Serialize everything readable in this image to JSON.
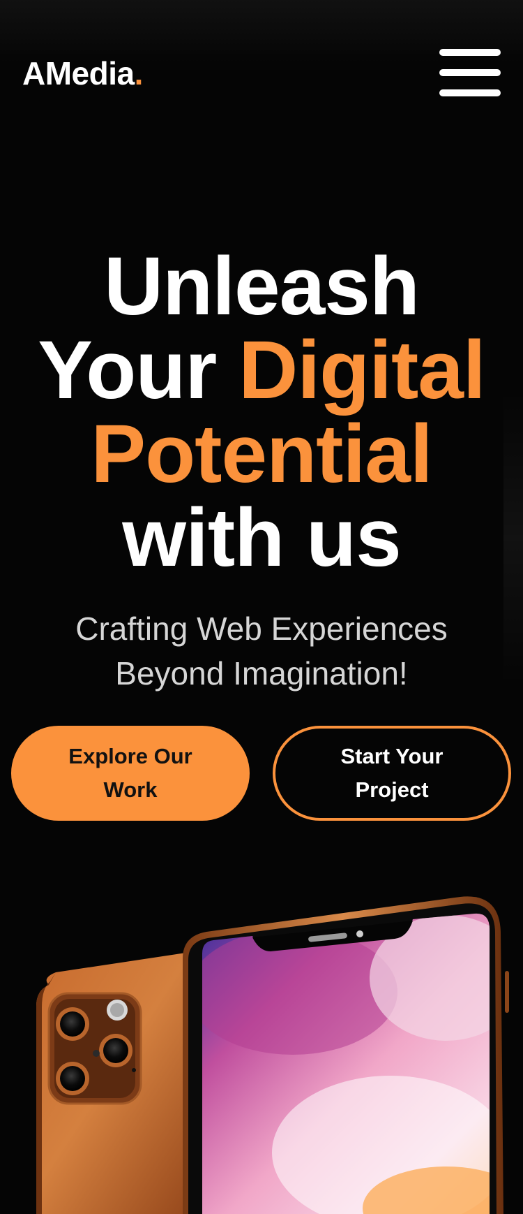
{
  "header": {
    "logo_text": "AMedia",
    "logo_dot": ".",
    "menu_icon": "hamburger-menu-icon"
  },
  "hero": {
    "headline_line1": "Unleash",
    "headline_line2_white": "Your ",
    "headline_line2_accent": "Digital",
    "headline_line3_accent": "Potential",
    "headline_line4": "with us",
    "subline_line1": "Crafting Web Experiences",
    "subline_line2": "Beyond Imagination!",
    "primary_button": "Explore Our Work",
    "secondary_button": "Start Your Project"
  },
  "image": {
    "subject": "phone-image"
  },
  "colors": {
    "background": "#050505",
    "accent": "#fb923c",
    "text": "#ffffff",
    "subtext": "#d6d6d6"
  }
}
